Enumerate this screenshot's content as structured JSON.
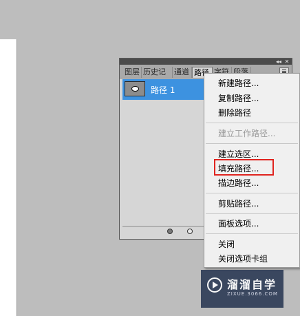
{
  "panel": {
    "titlebar": {
      "collapse_glyph": "◂◂",
      "close_glyph": "✕"
    },
    "tabs": [
      "图层",
      "历史记",
      "通道",
      "路径",
      "字符",
      "段落"
    ],
    "active_tab_index": 3,
    "paths": [
      {
        "label": "路径 1",
        "selected": true
      }
    ],
    "menu_button_icon": "panel-menu-icon",
    "footer_buttons": [
      "fill-path-icon",
      "stroke-path-icon"
    ]
  },
  "context_menu": {
    "items": [
      {
        "label": "新建路径...",
        "enabled": true
      },
      {
        "label": "复制路径...",
        "enabled": true
      },
      {
        "label": "删除路径",
        "enabled": true
      },
      {
        "label": "建立工作路径...",
        "enabled": false
      },
      {
        "label": "建立选区...",
        "enabled": true
      },
      {
        "label": "填充路径...",
        "enabled": true,
        "highlighted": true
      },
      {
        "label": "描边路径...",
        "enabled": true
      },
      {
        "label": "剪贴路径...",
        "enabled": true
      },
      {
        "label": "面板选项...",
        "enabled": true
      },
      {
        "label": "关闭",
        "enabled": true
      },
      {
        "label": "关闭选项卡组",
        "enabled": true
      }
    ]
  },
  "watermark": {
    "title": "溜溜自学",
    "subtitle": "ZIXUE.3066.COM"
  },
  "colors": {
    "selection_blue": "#3d92e0",
    "highlight_red": "#e0231e",
    "background": "#bdbdbd"
  }
}
